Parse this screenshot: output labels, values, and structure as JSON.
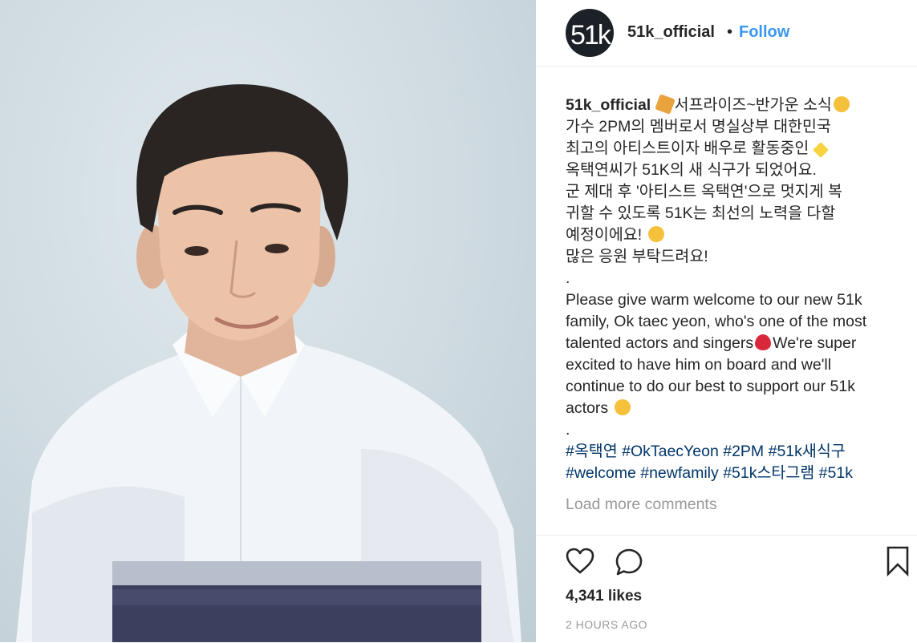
{
  "post": {
    "username": "51k_official",
    "separator": "•",
    "follow_label": "Follow",
    "avatar_text": "51k",
    "caption_lines": [
      "서프라이즈~반가운 소식",
      "가수 2PM의 멤버로서 명실상부 대한민국",
      "최고의 아티스트이자 배우로 활동중인",
      "옥택연씨가 51K의 새 식구가 되었어요.",
      "군 제대 후 '아티스트 옥택연'으로 멋지게 복",
      "귀할 수 있도록 51K는 최선의 노력을 다할",
      "예정이에요!",
      "많은 응원 부탁드려요!",
      ".",
      "Please give warm welcome to our new 51k",
      "family, Ok taec yeon, who's one of the most",
      "talented actors and singers",
      "We're super",
      "excited to have him on board and we'll",
      "continue to do our best to support our 51k",
      "actors",
      "."
    ],
    "hashtags": [
      "#옥택연",
      "#OkTaecYeon",
      "#2PM",
      "#51k새식구",
      "#welcome",
      "#newfamily",
      "#51k스타그램",
      "#51k"
    ],
    "load_more": "Load more comments",
    "likes": "4,341 likes",
    "time": "2 HOURS AGO"
  },
  "icons": [
    "heart-icon",
    "comment-icon",
    "bookmark-icon",
    "confetti-emoji",
    "clap-emoji",
    "sparkles-emoji",
    "hug-emoji",
    "heart-emoji",
    "thinking-emoji"
  ],
  "colors": {
    "link": "#3897f0",
    "hashtag": "#003569",
    "muted": "#999999",
    "text": "#262626"
  }
}
